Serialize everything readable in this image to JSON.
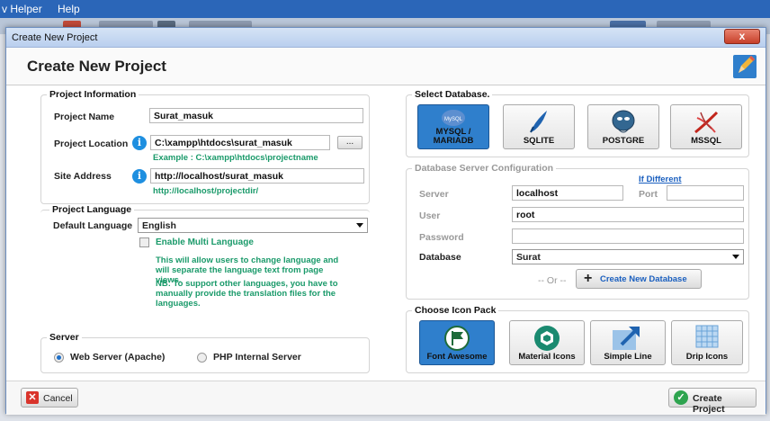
{
  "menubar": {
    "item1": "v Helper",
    "item2": "Help"
  },
  "dialog": {
    "title": "Create New Project",
    "close": "x",
    "heading": "Create New Project"
  },
  "project_info": {
    "title": "Project Information",
    "name_label": "Project Name",
    "name_value": "Surat_masuk",
    "location_label": "Project Location",
    "location_value": "C:\\xampp\\htdocs\\surat_masuk",
    "browse_label": "...",
    "location_hint": "Example : C:\\xampp\\htdocs\\projectname",
    "site_label": "Site Address",
    "site_value": "http://localhost/surat_masuk",
    "site_hint": "http://localhost/projectdir/",
    "info_glyph": "i"
  },
  "language": {
    "title": "Project Language",
    "default_label": "Default Language",
    "default_value": "English",
    "multi_label": "Enable Multi Language",
    "note1": "This will allow users to change language and will separate the language text from page views.",
    "note2": "NB: To support other languages, you have to manually provide the translation files for the languages."
  },
  "server": {
    "title": "Server",
    "opt1": "Web Server (Apache)",
    "opt2": "PHP Internal Server",
    "selected": "Web Server (Apache)"
  },
  "database": {
    "title": "Select Database.",
    "options": [
      "MYSQL / MARIADB",
      "SQLITE",
      "POSTGRE",
      "MSSQL"
    ],
    "mysql_line1": "MYSQL /",
    "mysql_line2": "MARIADB",
    "mysql_logo": "MySQL",
    "selected": "MYSQL / MARIADB"
  },
  "db_config": {
    "title": "Database Server Configuration",
    "if_different": "If Different",
    "server_label": "Server",
    "server_value": "localhost",
    "port_label": "Port",
    "port_value": "",
    "user_label": "User",
    "user_value": "root",
    "password_label": "Password",
    "password_value": "",
    "database_label": "Database",
    "database_value": "Surat",
    "or_text": "-- Or --",
    "create_db": "Create New Database",
    "plus": "+"
  },
  "icon_pack": {
    "title": "Choose Icon Pack",
    "options": [
      "Font Awesome",
      "Material Icons",
      "Simple Line",
      "Drip Icons"
    ],
    "selected": "Font Awesome"
  },
  "footer": {
    "cancel": "Cancel",
    "create": "Create Project"
  },
  "colors": {
    "accent": "#2f7fcc",
    "hint_green": "#1a9a6a",
    "menubar": "#2b66b8"
  }
}
